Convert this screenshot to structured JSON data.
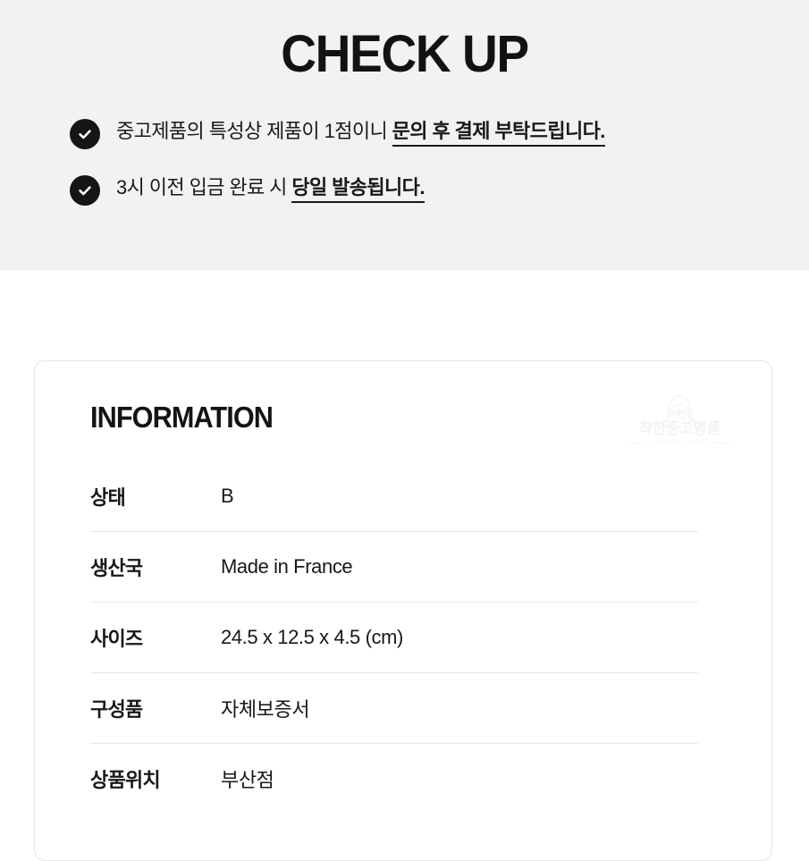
{
  "checkup": {
    "title": "CHECK UP",
    "bullets": [
      {
        "icon": "check-circle-icon",
        "normal": "중고제품의 특성상 제품이 1점이니 ",
        "emphasis": "문의 후 결제 부탁드립니다."
      },
      {
        "icon": "check-circle-icon",
        "normal": "3시 이전 입금 완료 시 ",
        "emphasis": "당일 발송됩니다."
      }
    ]
  },
  "information": {
    "title": "INFORMATION",
    "watermark": {
      "icon": "watch-clock-icon",
      "brand": "착한중고명품",
      "tagline": "LUXURY GOODS"
    },
    "rows": [
      {
        "label": "상태",
        "value": "B"
      },
      {
        "label": "생산국",
        "value": "Made in France"
      },
      {
        "label": "사이즈",
        "value": "24.5 x 12.5 x 4.5 (cm)"
      },
      {
        "label": "구성품",
        "value": "자체보증서"
      },
      {
        "label": "상품위치",
        "value": "부산점"
      }
    ]
  },
  "colors": {
    "band_background": "#f1f2f4",
    "page_background": "#ffffff",
    "text": "#17181a",
    "icon_fill": "#141517",
    "divider": "#e7e8ea",
    "card_border": "#e4e5e7",
    "watermark": "#f3f3f4"
  }
}
